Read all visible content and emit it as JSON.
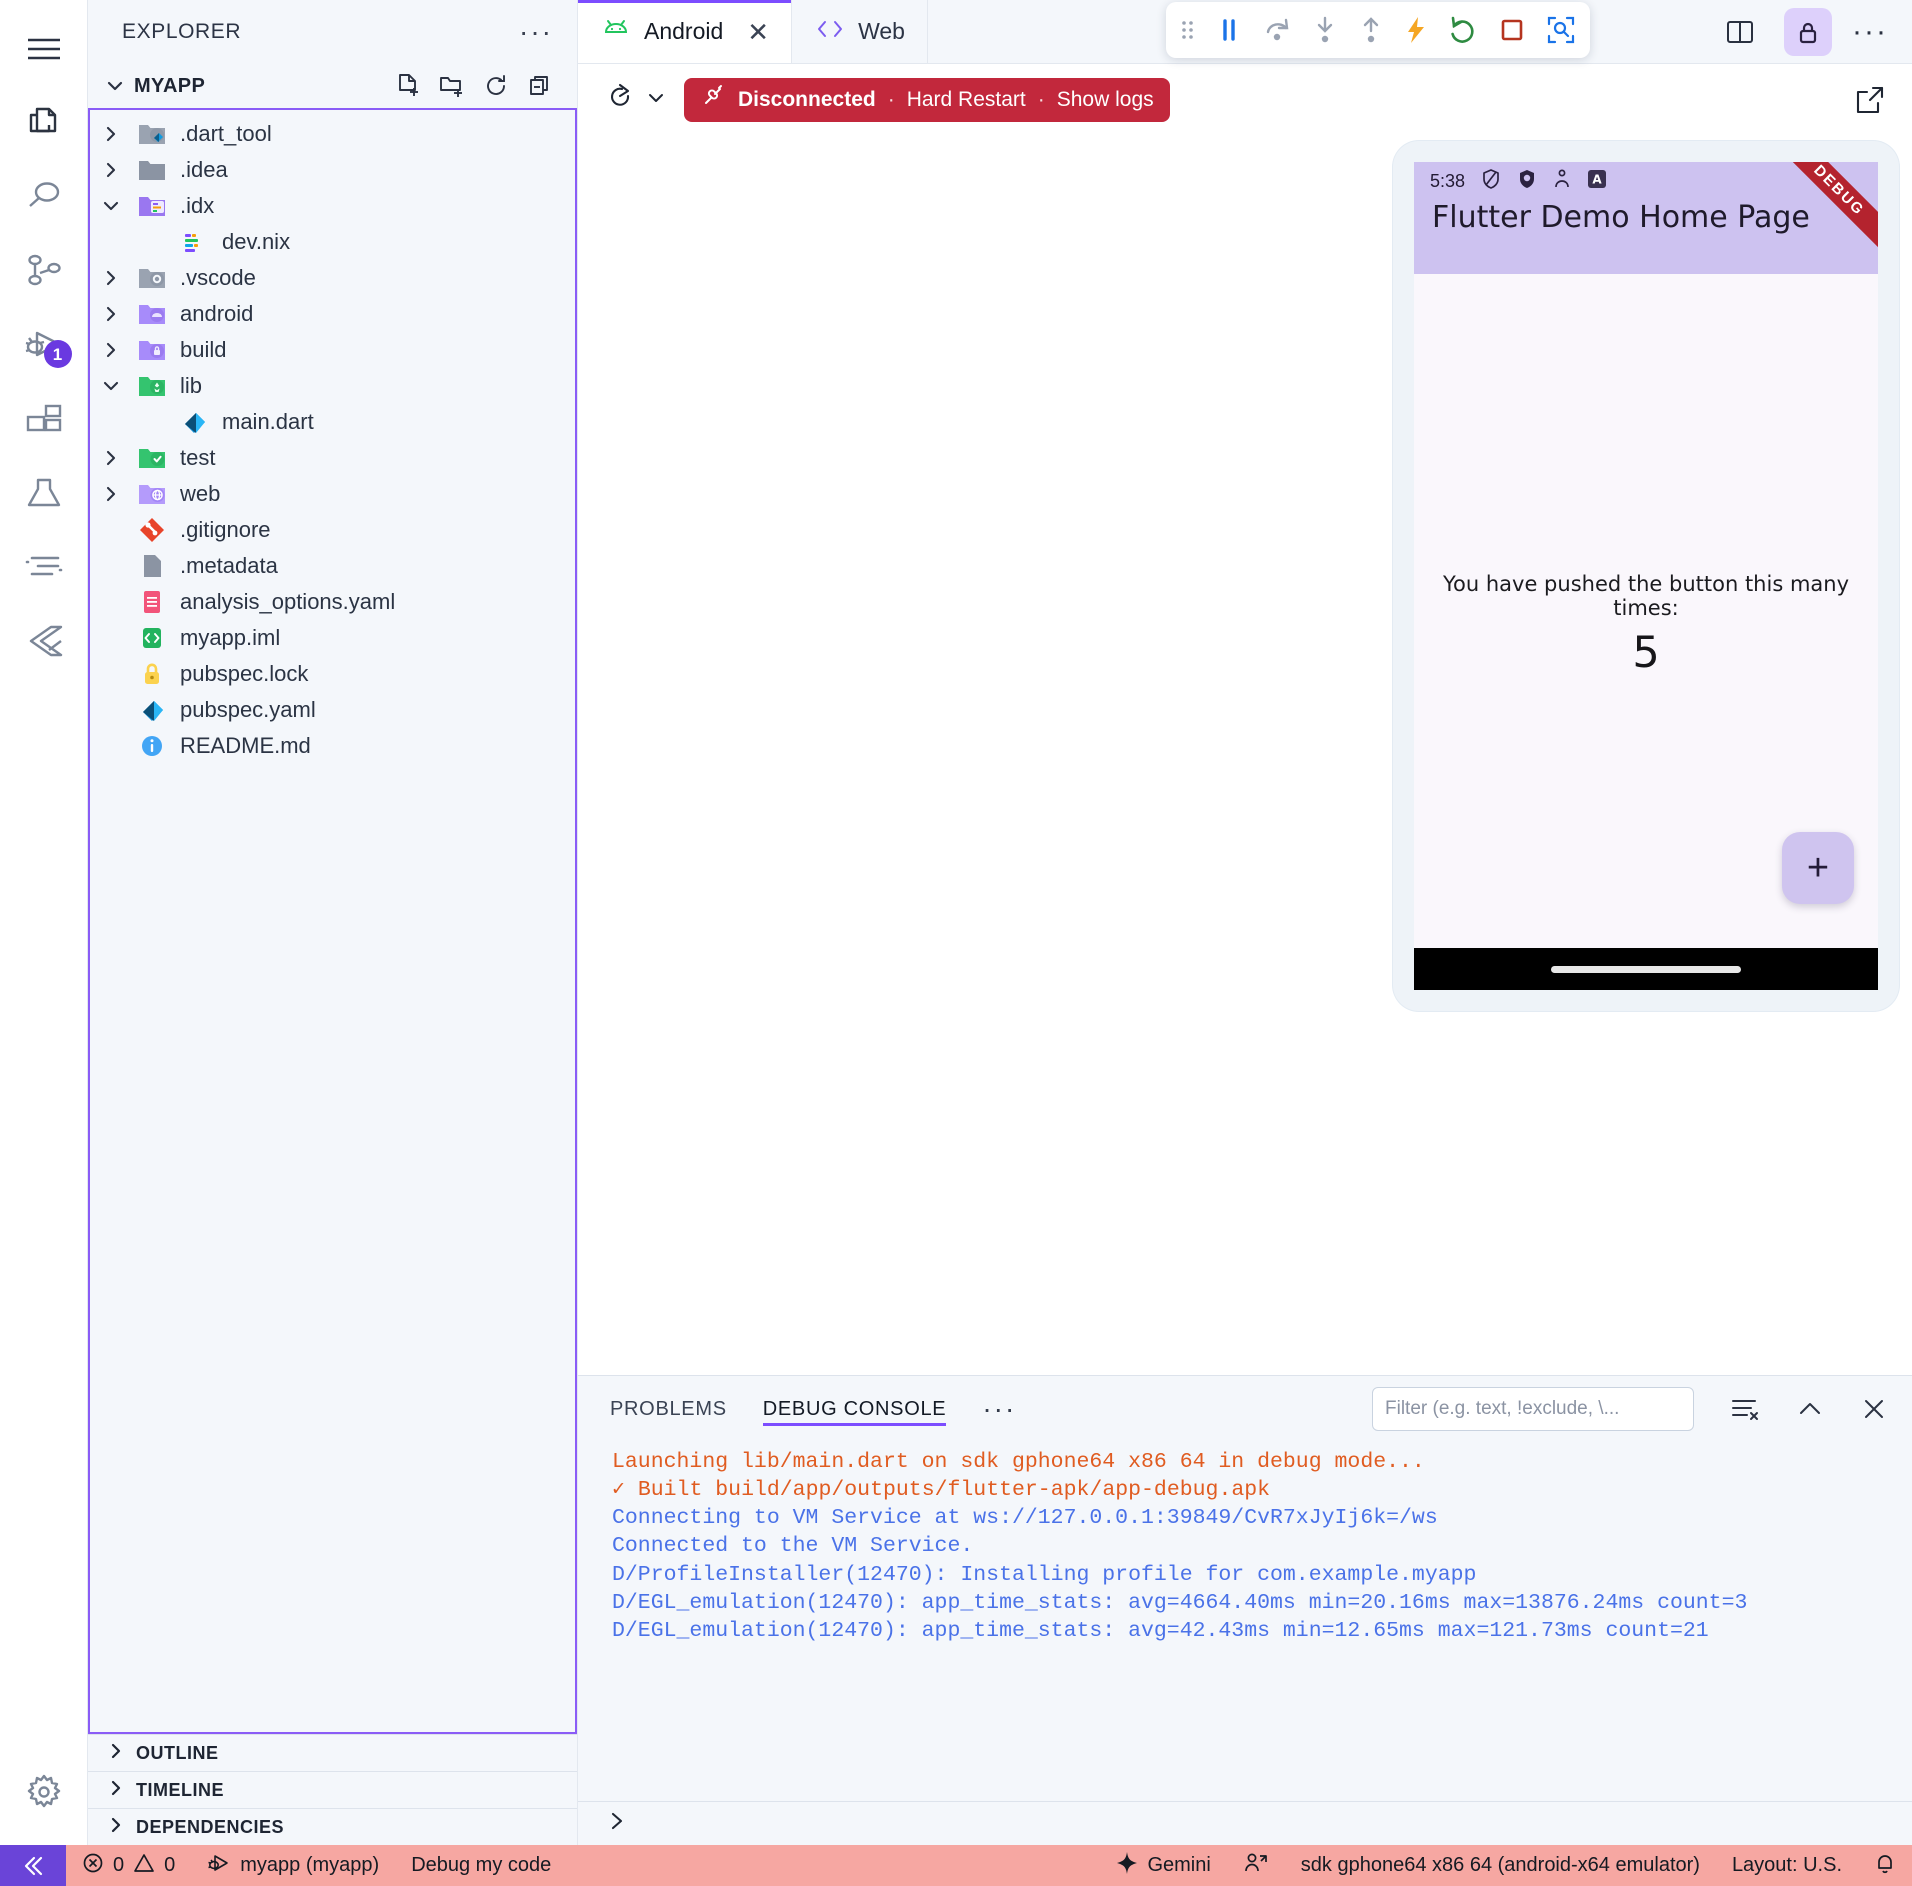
{
  "activity_bar": {
    "items": [
      {
        "name": "menu-icon",
        "label": "Menu"
      },
      {
        "name": "explorer-icon",
        "label": "Explorer"
      },
      {
        "name": "search-icon",
        "label": "Search"
      },
      {
        "name": "source-control-icon",
        "label": "Source Control"
      },
      {
        "name": "run-and-debug-icon",
        "label": "Run and Debug",
        "badge": "1"
      },
      {
        "name": "extensions-icon",
        "label": "Extensions"
      },
      {
        "name": "testing-icon",
        "label": "Testing"
      },
      {
        "name": "output-icon",
        "label": "Output"
      },
      {
        "name": "flutter-icon",
        "label": "Flutter"
      }
    ],
    "settings": {
      "name": "gear-icon",
      "label": "Manage"
    }
  },
  "sidebar": {
    "title": "EXPLORER",
    "more_label": "···",
    "project": {
      "name": "MYAPP",
      "actions": [
        "new-file",
        "new-folder",
        "refresh",
        "collapse-all"
      ]
    },
    "tree": [
      {
        "label": ".dart_tool",
        "type": "folder",
        "expanded": false,
        "depth": 0,
        "icon": "folder-dart"
      },
      {
        "label": ".idea",
        "type": "folder",
        "expanded": false,
        "depth": 0,
        "icon": "folder-plain"
      },
      {
        "label": ".idx",
        "type": "folder",
        "expanded": true,
        "depth": 0,
        "icon": "folder-idx"
      },
      {
        "label": "dev.nix",
        "type": "file",
        "depth": 1,
        "icon": "nix"
      },
      {
        "label": ".vscode",
        "type": "folder",
        "expanded": false,
        "depth": 0,
        "icon": "folder-vscode"
      },
      {
        "label": "android",
        "type": "folder",
        "expanded": false,
        "depth": 0,
        "icon": "folder-android"
      },
      {
        "label": "build",
        "type": "folder",
        "expanded": false,
        "depth": 0,
        "icon": "folder-build"
      },
      {
        "label": "lib",
        "type": "folder",
        "expanded": true,
        "depth": 0,
        "icon": "folder-lib"
      },
      {
        "label": "main.dart",
        "type": "file",
        "depth": 1,
        "icon": "dart"
      },
      {
        "label": "test",
        "type": "folder",
        "expanded": false,
        "depth": 0,
        "icon": "folder-test"
      },
      {
        "label": "web",
        "type": "folder",
        "expanded": false,
        "depth": 0,
        "icon": "folder-web"
      },
      {
        "label": ".gitignore",
        "type": "file",
        "depth": 0,
        "icon": "git"
      },
      {
        "label": ".metadata",
        "type": "file",
        "depth": 0,
        "icon": "blank"
      },
      {
        "label": "analysis_options.yaml",
        "type": "file",
        "depth": 0,
        "icon": "yaml"
      },
      {
        "label": "myapp.iml",
        "type": "file",
        "depth": 0,
        "icon": "xml"
      },
      {
        "label": "pubspec.lock",
        "type": "file",
        "depth": 0,
        "icon": "lock"
      },
      {
        "label": "pubspec.yaml",
        "type": "file",
        "depth": 0,
        "icon": "dart"
      },
      {
        "label": "README.md",
        "type": "file",
        "depth": 0,
        "icon": "info"
      }
    ],
    "panels": [
      {
        "label": "OUTLINE"
      },
      {
        "label": "TIMELINE"
      },
      {
        "label": "DEPENDENCIES"
      }
    ]
  },
  "editor": {
    "tabs": [
      {
        "label": "Android",
        "icon": "android-icon",
        "active": true,
        "closable": true,
        "close_label": "✕"
      },
      {
        "label": "Web",
        "icon": "code-icon",
        "active": false,
        "closable": false,
        "close_label": ""
      }
    ],
    "debug_toolbar": {
      "buttons": [
        {
          "name": "drag-handle-icon",
          "title": "Drag"
        },
        {
          "name": "pause-icon",
          "title": "Pause"
        },
        {
          "name": "step-over-icon",
          "title": "Step Over"
        },
        {
          "name": "step-into-icon",
          "title": "Step Into"
        },
        {
          "name": "step-out-icon",
          "title": "Step Out"
        },
        {
          "name": "hot-reload-icon",
          "title": "Hot Reload"
        },
        {
          "name": "hot-restart-icon",
          "title": "Hot Restart"
        },
        {
          "name": "stop-icon",
          "title": "Stop"
        },
        {
          "name": "inspect-widget-icon",
          "title": "Inspect Widget"
        }
      ]
    },
    "right_actions": [
      {
        "name": "split-editor-icon",
        "active": false
      },
      {
        "name": "lock-icon",
        "active": true
      },
      {
        "name": "more-actions-icon",
        "active": false
      }
    ],
    "runbar": {
      "restart_label": "",
      "banner": {
        "status": "Disconnected",
        "sep1": "·",
        "action1": "Hard Restart",
        "sep2": "·",
        "action2": "Show logs",
        "color": "#c2283c"
      },
      "open_external_label": ""
    }
  },
  "device": {
    "status_time": "5:38",
    "status_icons": [
      "shield-outline-icon",
      "shield-filled-icon",
      "vpn-key-icon",
      "alpha-badge-icon"
    ],
    "app_title": "Flutter Demo Home Page",
    "debug_ribbon": "DEBUG",
    "counter_label": "You have pushed the button this many times:",
    "counter_value": "5",
    "fab_label": "+",
    "appbar_color": "#cdc2f0",
    "fab_color": "#cfc4ef"
  },
  "console": {
    "tabs": [
      {
        "label": "PROBLEMS",
        "active": false
      },
      {
        "label": "DEBUG CONSOLE",
        "active": true
      }
    ],
    "more_label": "···",
    "filter_placeholder": "Filter (e.g. text, !exclude, \\...",
    "filter_value": "",
    "actions": [
      "clear-console-icon",
      "collapse-panel-icon",
      "close-panel-icon"
    ],
    "lines": [
      {
        "text": "Launching lib/main.dart on sdk gphone64 x86 64 in debug mode...",
        "color": "orange"
      },
      {
        "text": "✓ Built build/app/outputs/flutter-apk/app-debug.apk",
        "color": "orange"
      },
      {
        "text": "Connecting to VM Service at ws://127.0.0.1:39849/CvR7xJyIj6k=/ws",
        "color": "blue"
      },
      {
        "text": "Connected to the VM Service.",
        "color": "blue"
      },
      {
        "text": "D/ProfileInstaller(12470): Installing profile for com.example.myapp",
        "color": "blue"
      },
      {
        "text": "D/EGL_emulation(12470): app_time_stats: avg=4664.40ms min=20.16ms max=13876.24ms count=3",
        "color": "blue"
      },
      {
        "text": "D/EGL_emulation(12470): app_time_stats: avg=42.43ms min=12.65ms max=121.73ms count=21",
        "color": "blue"
      }
    ],
    "prompt": "❯"
  },
  "statusbar": {
    "background": "#f6a7a2",
    "remote_icon": "remote-window-icon",
    "problems": {
      "errors": "0",
      "warnings": "0"
    },
    "debug_target": "myapp (myapp)",
    "debug_action": "Debug my code",
    "gemini": "Gemini",
    "account_icon": "account-icon",
    "device": "sdk gphone64 x86 64 (android-x64 emulator)",
    "layout": "Layout: U.S.",
    "bell_icon": "bell-icon"
  }
}
